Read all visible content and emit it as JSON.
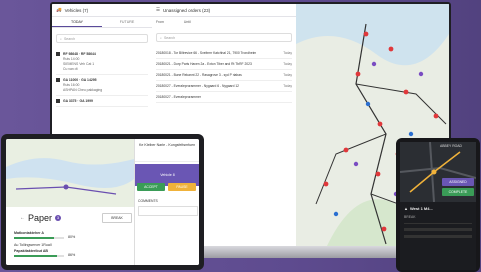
{
  "laptop": {
    "vehicles": {
      "title": "Vehicles (7)",
      "tabs": [
        "TODAY",
        "FUTURE"
      ],
      "search_placeholder": "Search",
      "rows": [
        {
          "title": "RF 98648 · RF 58644",
          "sub": "Ruts 14:00",
          "line": "SIEMENS Veh Cat 1",
          "meta": "Cu van dt"
        },
        {
          "title": "GA 11000 · GA 14295",
          "sub": "Ruts 16:00",
          "line": "ASHPAN Cheu pakkaging",
          "meta": ""
        },
        {
          "title": "GA 3375 · GA 1999",
          "sub": "",
          "line": "",
          "meta": ""
        }
      ]
    },
    "unassigned": {
      "title": "Unassigned orders (23)",
      "filter_labels": [
        "From",
        "Until"
      ],
      "search_placeholder": "Search",
      "orders": [
        {
          "id": "20180018 - Tor Biltrevice 66 - Sveitrmr Katchhal 21, 7900 Trondheim",
          "date": "Today"
        },
        {
          "id": "20180021 - Dorp Paris Haven 2a - Exton Tiber and Rt TbRF 2023",
          "date": "Today"
        },
        {
          "id": "20180021 - Bune Rekannt 22 - Rasagrove 3 - syd P riabas",
          "date": "Today"
        },
        {
          "id": "20180027 - Everaleprorammer - Nygaard 6 - Nygaard 12",
          "date": "Today"
        },
        {
          "id": "20180027 - Everaleprorammer",
          "date": ""
        }
      ]
    }
  },
  "tablet": {
    "app_name": "Paper",
    "side_header": "Ke Kleiber Narle - Kungsfeltsmfuen",
    "side_button": "Vehicle 8",
    "actions": [
      "ACCEPT",
      "PAUSE"
    ],
    "rows": [
      {
        "label": "Matkontakteher A",
        "value": "80%"
      },
      {
        "label": "Au Tollingwerver 1Ruall",
        "value": ""
      },
      {
        "label": "Papakitakteribut AB",
        "value": "86%"
      }
    ],
    "right_button": "BREAK",
    "comments_label": "COMMENTS"
  },
  "phone": {
    "title": "West 1 M4...",
    "sub": "BREAK",
    "top_label": "ABBEY ROAD",
    "actions": [
      "ASSIGNED",
      "COMPLETE"
    ]
  }
}
